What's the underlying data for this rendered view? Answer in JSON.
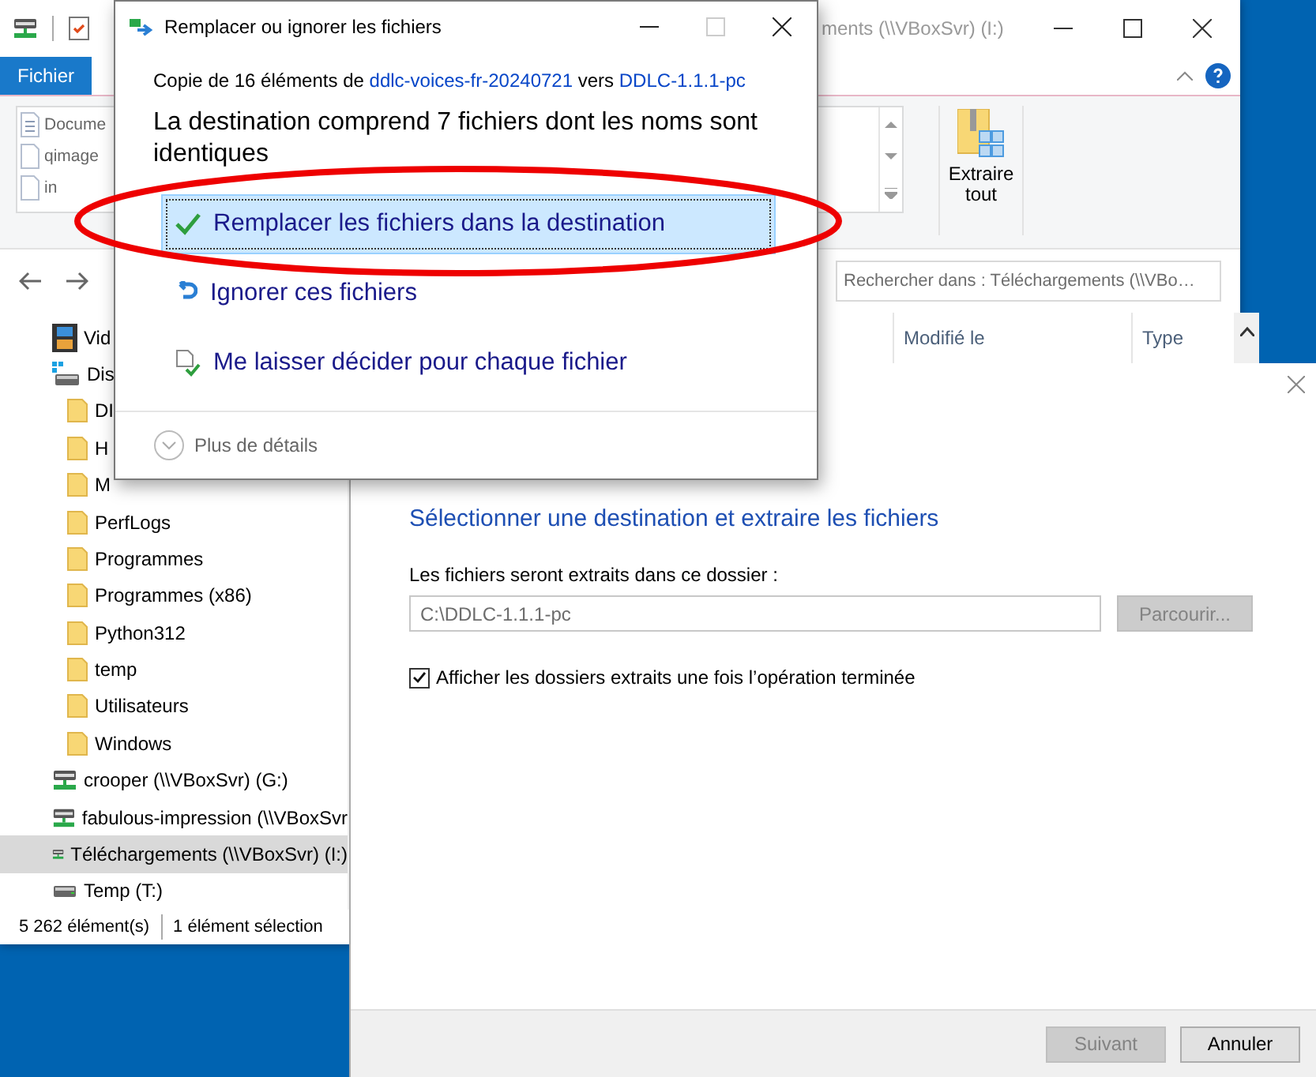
{
  "explorer": {
    "title": "ments (\\\\VBoxSvr) (I:)",
    "ribbon_tabs": [
      {
        "label": "Fichier",
        "kind": "file-menu"
      }
    ],
    "recent_items": [
      {
        "label": "Docume",
        "kind": "document"
      },
      {
        "label": "qimage",
        "kind": "file"
      },
      {
        "label": "in",
        "kind": "file"
      }
    ],
    "extract_button": "Extraire tout",
    "search": {
      "placeholder": "Rechercher dans : Téléchargements (\\\\VBo…"
    },
    "columns": [
      "Modifié le",
      "Type"
    ],
    "tree": [
      {
        "label": "Vid",
        "kind": "videos",
        "selected": false
      },
      {
        "label": "Dis",
        "kind": "system-drive",
        "selected": false,
        "children": [
          {
            "label": "DI",
            "kind": "folder",
            "selected": false
          },
          {
            "label": "H",
            "kind": "folder",
            "selected": false
          },
          {
            "label": "M",
            "kind": "folder",
            "selected": false
          },
          {
            "label": "PerfLogs",
            "kind": "folder",
            "selected": false
          },
          {
            "label": "Programmes",
            "kind": "folder",
            "selected": false
          },
          {
            "label": "Programmes (x86)",
            "kind": "folder",
            "selected": false
          },
          {
            "label": "Python312",
            "kind": "folder",
            "selected": false
          },
          {
            "label": "temp",
            "kind": "folder",
            "selected": false
          },
          {
            "label": "Utilisateurs",
            "kind": "folder",
            "selected": false
          },
          {
            "label": "Windows",
            "kind": "folder",
            "selected": false
          }
        ]
      },
      {
        "label": "crooper (\\\\VBoxSvr) (G:)",
        "kind": "network-drive",
        "selected": false
      },
      {
        "label": "fabulous-impression (\\\\VBoxSvr",
        "kind": "network-drive",
        "selected": false
      },
      {
        "label": "Téléchargements (\\\\VBoxSvr) (I:)",
        "kind": "network-drive",
        "selected": true
      },
      {
        "label": "Temp (T:)",
        "kind": "drive",
        "selected": false
      }
    ],
    "status_bar": [
      "5 262 élément(s)",
      "1 élément sélection"
    ]
  },
  "wizard": {
    "heading": "Sélectionner une destination et extraire les fichiers",
    "folder_label": "Les fichiers seront extraits dans ce dossier :",
    "path": {
      "value": "C:\\DDLC-1.1.1-pc",
      "disabled": true
    },
    "browse": {
      "label": "Parcourir...",
      "disabled": true
    },
    "show_folders": {
      "label": "Afficher les dossiers extraits une fois l’opération terminée",
      "checked": true
    },
    "buttons": [
      {
        "label": "Suivant",
        "disabled": true
      },
      {
        "label": "Annuler",
        "disabled": false
      }
    ]
  },
  "replace_dialog": {
    "title": "Remplacer ou ignorer les fichiers",
    "copy_line": {
      "prefix": "Copie de 16 éléments de",
      "source": "ddlc-voices-fr-20240721",
      "middle": "vers",
      "destination": "DDLC-1.1.1-pc"
    },
    "headline": "La destination comprend 7 fichiers dont les noms sont identiques",
    "options": [
      {
        "label": "Remplacer les fichiers dans la destination",
        "kind": "replace",
        "selected": true
      },
      {
        "label": "Ignorer ces fichiers",
        "kind": "skip",
        "selected": false
      },
      {
        "label": "Me laisser décider pour chaque fichier",
        "kind": "decide",
        "selected": false
      }
    ],
    "details": "Plus de détails"
  }
}
